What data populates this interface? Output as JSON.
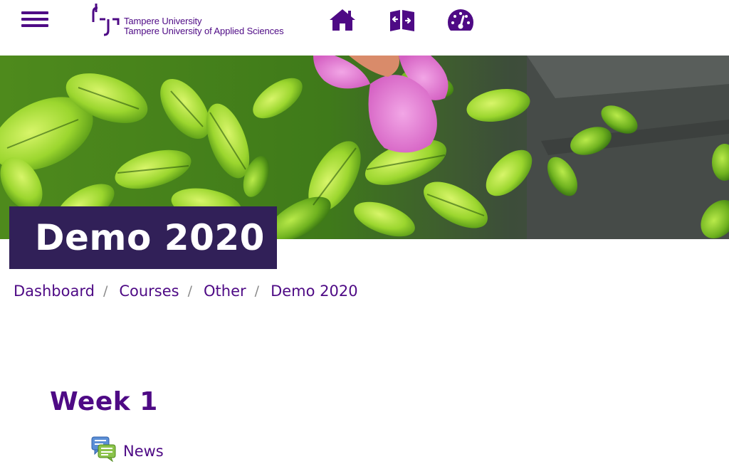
{
  "header": {
    "menu_icon": "hamburger-menu-icon",
    "logo": {
      "line1": "Tampere University",
      "line2": "Tampere University of Applied Sciences"
    },
    "nav_icons": [
      "home-icon",
      "map-book-icon",
      "dashboard-gauge-icon"
    ]
  },
  "course": {
    "title": "Demo 2020"
  },
  "breadcrumb": {
    "items": [
      "Dashboard",
      "Courses",
      "Other",
      "Demo 2020"
    ],
    "separator": "/"
  },
  "section": {
    "title": "Week 1",
    "activities": [
      {
        "label": "News",
        "icon": "forum-icon"
      }
    ]
  },
  "colors": {
    "brand": "#4e0a85",
    "title_bg": "#312058"
  }
}
